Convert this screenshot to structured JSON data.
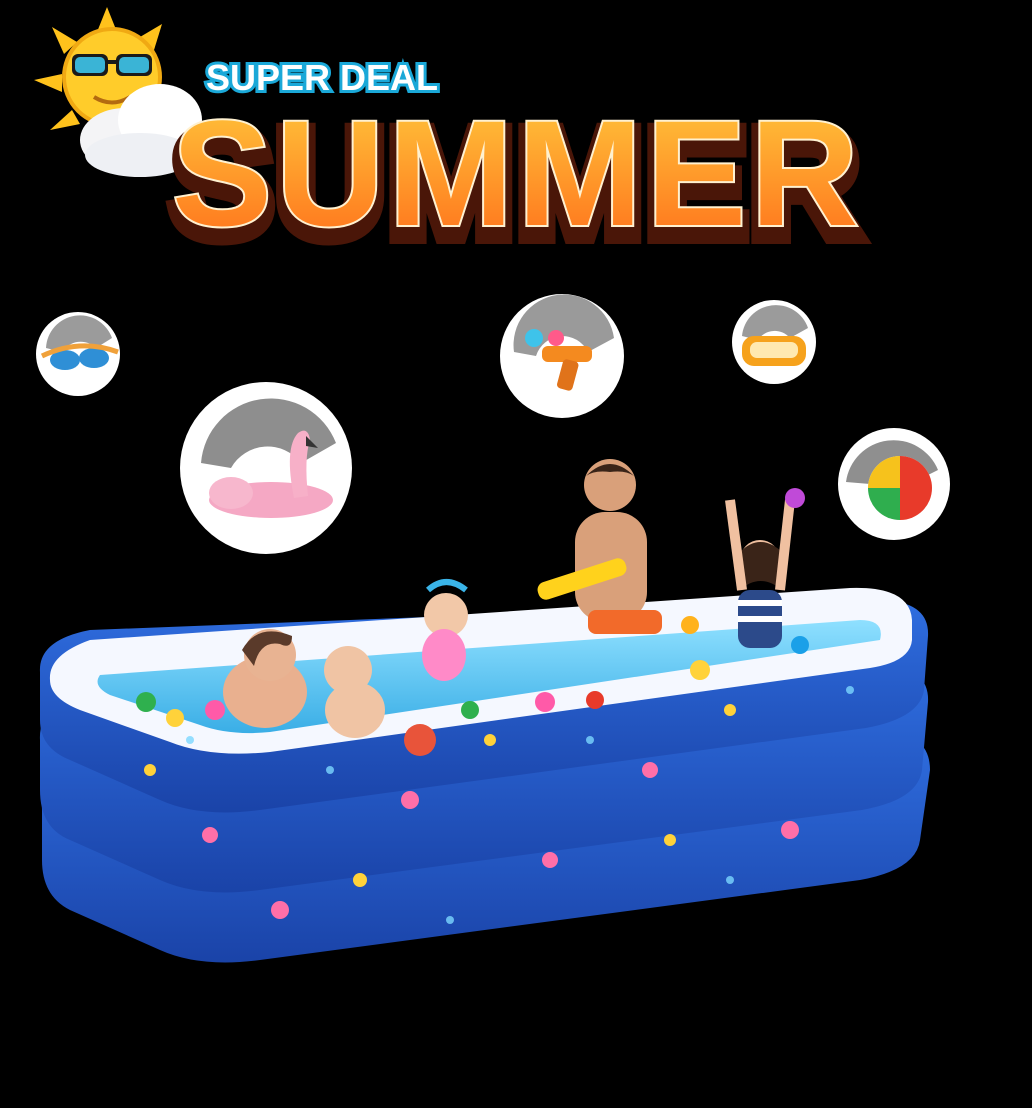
{
  "header": {
    "subtitle": "SUPER DEAL",
    "title": "SUMMER"
  },
  "icons": [
    "sun-with-sunglasses-icon",
    "cloud-icon",
    "swim-goggles-icon",
    "flamingo-float-icon",
    "water-gun-icon",
    "mini-pool-icon",
    "beach-ball-icon"
  ],
  "colors": {
    "background": "#000000",
    "title_fill": "#ff9a1f",
    "title_outline": "#7a2a10",
    "subtitle_fill": "#ffffff",
    "subtitle_outline": "#1aa8d8",
    "pool_blue": "#1c57c7",
    "pool_rim": "#f5f8ff",
    "water": "#5fc6f0"
  }
}
